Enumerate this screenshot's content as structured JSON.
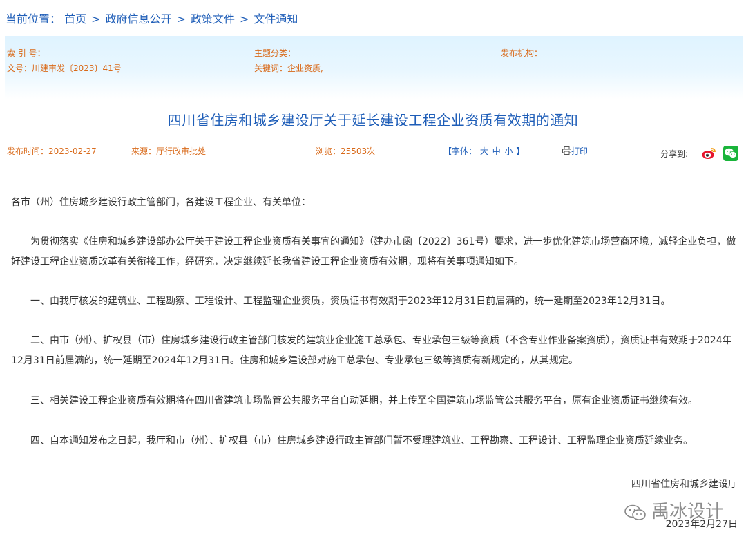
{
  "breadcrumb": {
    "prefix": "当前位置：",
    "items": [
      "首页",
      "政府信息公开",
      "政策文件",
      "文件通知"
    ],
    "separator": ">"
  },
  "meta": {
    "index_no_label": "索 引 号：",
    "topic_label": "主题分类：",
    "issuer_label": "发布机构：",
    "doc_no": "文号：川建审发〔2023〕41号",
    "keywords": "关键词：企业资质,"
  },
  "title": "四川省住房和城乡建设厅关于延长建设工程企业资质有效期的通知",
  "info": {
    "publish_time": "发布时间：2023-02-27",
    "source": "来源：厅行政审批处",
    "views": "浏览：25503次",
    "font_open": "【字体：",
    "font_large": "大",
    "font_medium": "中",
    "font_small": "小",
    "font_close": "】",
    "print": "打印",
    "share_label": "分享到:"
  },
  "body": {
    "salutation": "各市（州）住房城乡建设行政主管部门，各建设工程企业、有关单位：",
    "intro": "为贯彻落实《住房和城乡建设部办公厅关于建设工程企业资质有关事宜的通知》（建办市函〔2022〕361号）要求，进一步优化建筑市场营商环境，减轻企业负担，做好建设工程企业资质改革有关衔接工作，经研究，决定继续延长我省建设工程企业资质有效期，现将有关事项通知如下。",
    "item1": "一、由我厅核发的建筑业、工程勘察、工程设计、工程监理企业资质，资质证书有效期于2023年12月31日前届满的，统一延期至2023年12月31日。",
    "item2": "二、由市（州）、扩权县（市）住房城乡建设行政主管部门核发的建筑业企业施工总承包、专业承包三级等资质（不含专业作业备案资质），资质证书有效期于2024年12月31日前届满的，统一延期至2024年12月31日。住房和城乡建设部对施工总承包、专业承包三级等资质有新规定的，从其规定。",
    "item3": "三、相关建设工程企业资质有效期将在四川省建筑市场监管公共服务平台自动延期，并上传至全国建筑市场监管公共服务平台，原有企业资质证书继续有效。",
    "item4": "四、自本通知发布之日起，我厅和市（州）、扩权县（市）住房城乡建设行政主管部门暂不受理建筑业、工程勘察、工程设计、工程监理企业资质延续业务。",
    "signature": "四川省住房和城乡建设厅",
    "date": "2023年2月27日"
  },
  "watermark": {
    "text": "禹冰设计",
    "icon": "wechat-icon"
  },
  "colors": {
    "link_blue": "#1f5eb8",
    "meta_orange": "#d96a1a",
    "wechat_green": "#19b43a",
    "weibo_red": "#e6162d"
  }
}
